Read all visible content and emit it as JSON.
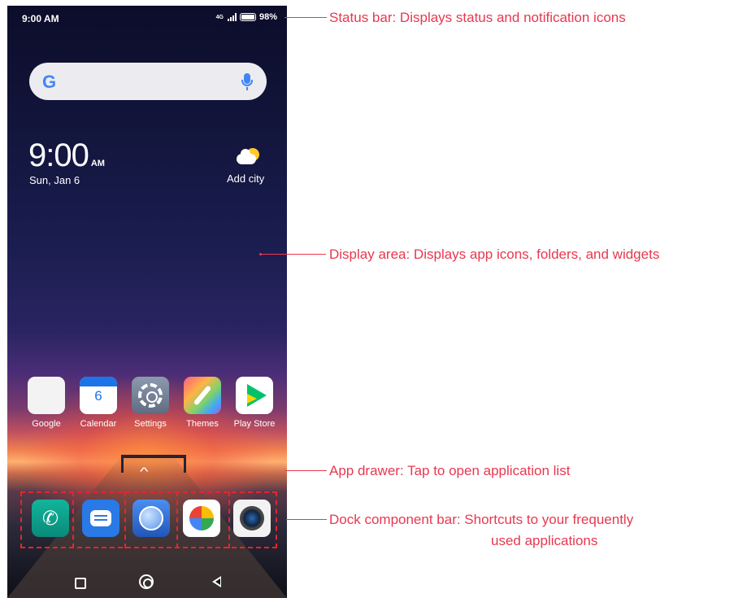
{
  "status_bar": {
    "time": "9:00 AM",
    "network": "4G",
    "battery": "98%"
  },
  "search_bar": {
    "logo": "G",
    "icons": [
      "google-logo",
      "mic-icon"
    ]
  },
  "clock_widget": {
    "time": "9:00",
    "ampm": "AM",
    "date": "Sun, Jan 6",
    "weather_label": "Add city"
  },
  "home_apps": [
    {
      "label": "Google",
      "icon": "google-folder-icon"
    },
    {
      "label": "Calendar",
      "icon": "calendar-icon",
      "number": "6"
    },
    {
      "label": "Settings",
      "icon": "settings-gear-icon"
    },
    {
      "label": "Themes",
      "icon": "themes-brush-icon"
    },
    {
      "label": "Play Store",
      "icon": "play-store-icon"
    }
  ],
  "dock_apps": [
    {
      "icon": "phone-icon"
    },
    {
      "icon": "messages-icon"
    },
    {
      "icon": "browser-icon"
    },
    {
      "icon": "photos-icon"
    },
    {
      "icon": "camera-icon"
    }
  ],
  "nav_bar": {
    "icons": [
      "recent-apps-icon",
      "home-icon",
      "back-icon"
    ]
  },
  "callouts": {
    "status_bar": "Status bar: Displays status and notification icons",
    "display_area": "Display area: Displays app icons, folders, and widgets",
    "app_drawer": "App drawer: Tap to open application list",
    "dock_line1": "Dock component bar: Shortcuts to your frequently",
    "dock_line2": "used applications"
  },
  "colors": {
    "callout": "#e8384f",
    "dock_outline": "#e3262e"
  }
}
